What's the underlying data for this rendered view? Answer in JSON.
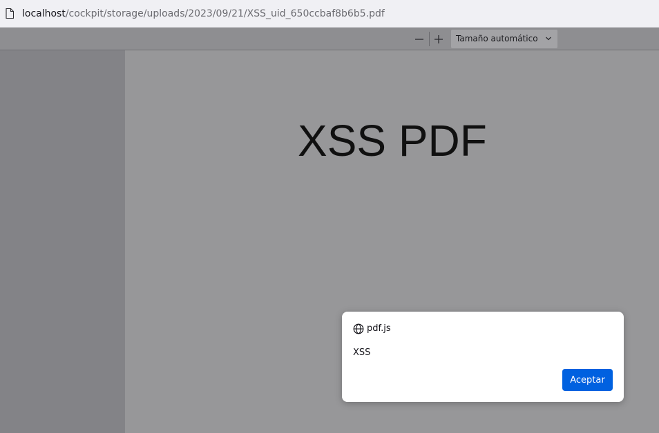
{
  "browser": {
    "url_host": "localhost",
    "url_path": "/cockpit/storage/uploads/2023/09/21/XSS_uid_650ccbaf8b6b5.pdf",
    "page_icon": "page-icon"
  },
  "toolbar": {
    "zoom_out_icon": "minus-icon",
    "zoom_in_icon": "plus-icon",
    "scale_value": "Tamaño automático",
    "scale_icon": "chevron-down-icon"
  },
  "document": {
    "heading": "XSS PDF"
  },
  "alert_dialog": {
    "origin": "pdf.js",
    "origin_icon": "globe-icon",
    "message": "XSS",
    "ok_label": "Aceptar",
    "button_color": "#0061e0"
  }
}
